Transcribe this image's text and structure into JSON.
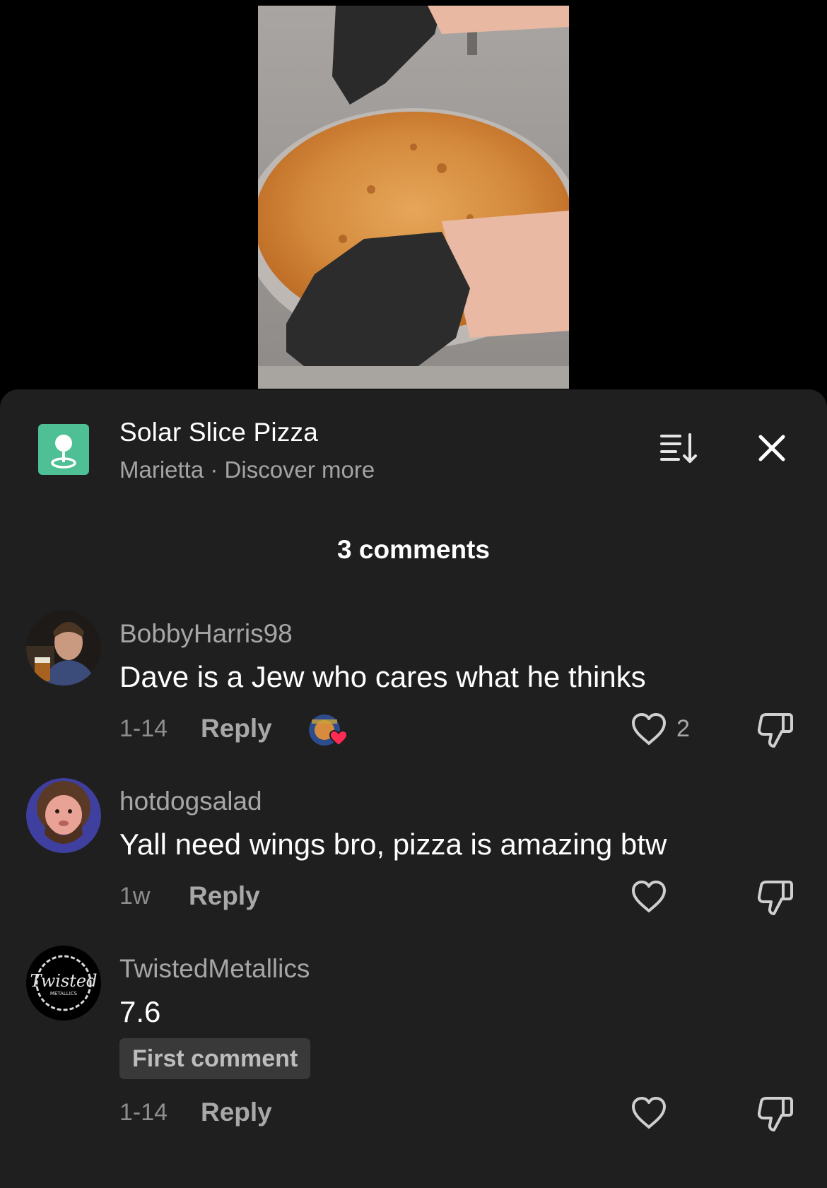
{
  "place": {
    "name": "Solar Slice Pizza",
    "subtitle": "Marietta · Discover more",
    "icon": "location-pin-icon"
  },
  "header": {
    "sort_icon": "sort-icon",
    "close_icon": "close-icon",
    "comment_count": "3 comments"
  },
  "comments": [
    {
      "username": "BobbyHarris98",
      "text": "Dave is a Jew who cares what he thinks",
      "time": "1-14",
      "reply_label": "Reply",
      "likes": "2",
      "creator_liked": true
    },
    {
      "username": "hotdogsalad",
      "text": "Yall need wings bro, pizza is amazing btw",
      "time": "1w",
      "reply_label": "Reply",
      "likes": ""
    },
    {
      "username": "TwistedMetallics",
      "text": "7.6",
      "badge": "First comment",
      "time": "1-14",
      "reply_label": "Reply",
      "likes": "",
      "avatar_logo_text": "Twisted METALLICS"
    }
  ],
  "colors": {
    "sheet_bg": "#1f1f1f",
    "place_icon_bg": "#4fbf95",
    "heart_red": "#fe2c55"
  }
}
